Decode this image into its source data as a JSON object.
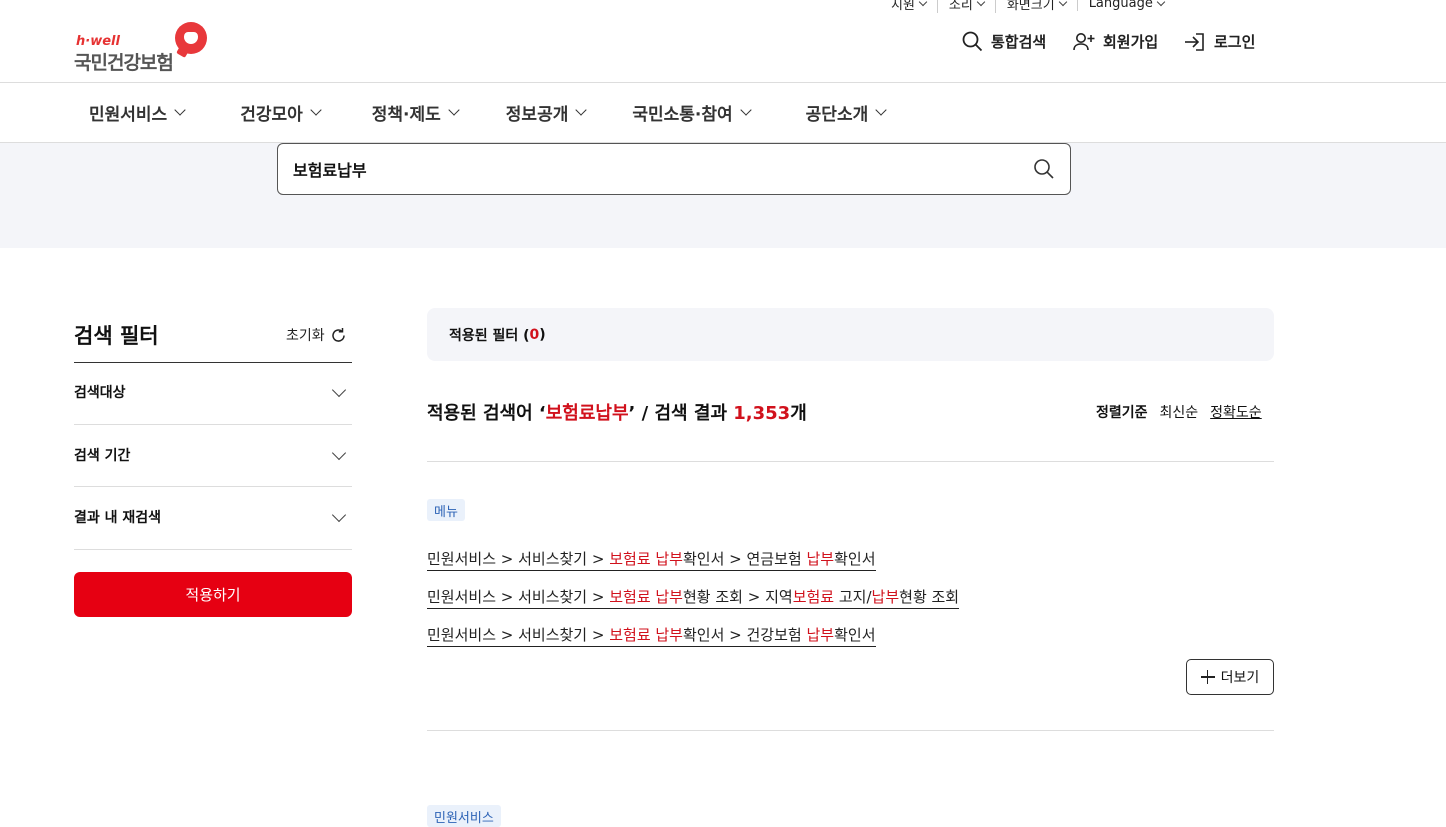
{
  "utility": [
    {
      "label": "지원"
    },
    {
      "label": "소리"
    },
    {
      "label": "화면크기"
    },
    {
      "label": "Language"
    }
  ],
  "logo": {
    "brand": "h·well",
    "name": "국민건강보험"
  },
  "header": {
    "search_label": "통합검색",
    "signup_label": "회원가입",
    "login_label": "로그인"
  },
  "gnb": [
    {
      "label": "민원서비스"
    },
    {
      "label": "건강모아"
    },
    {
      "label": "정책·제도"
    },
    {
      "label": "정보공개"
    },
    {
      "label": "국민소통·참여"
    },
    {
      "label": "공단소개"
    }
  ],
  "search": {
    "value": "보험료납부"
  },
  "filter": {
    "title": "검색 필터",
    "reset_label": "초기화",
    "sections": [
      {
        "label": "검색대상"
      },
      {
        "label": "검색 기간"
      },
      {
        "label": "결과 내 재검색"
      }
    ],
    "apply_label": "적용하기"
  },
  "applied": {
    "label": "적용된 필터 (",
    "count": "0",
    "close": ")"
  },
  "summary": {
    "prefix": "적용된 검색어 ‘",
    "keyword": "보험료납부",
    "middle": "’ / 검색 결과 ",
    "count": "1,353",
    "suffix": "개"
  },
  "sort": {
    "label": "정렬기준",
    "latest": "최신순",
    "accuracy": "정확도순"
  },
  "menu_section": {
    "tag": "메뉴",
    "paths": [
      [
        "민원서비스 > 서비스찾기 > ",
        "보험료 납부",
        "확인서 > 연금보험 ",
        "납부",
        "확인서"
      ],
      [
        "민원서비스 > 서비스찾기 > ",
        "보험료 납부",
        "현황 조회 > 지역",
        "보험료",
        " 고지/",
        "납부",
        "현황 조회"
      ],
      [
        "민원서비스 > 서비스찾기 > ",
        "보험료 납부",
        "확인서 > 건강보험 ",
        "납부",
        "확인서"
      ]
    ],
    "more_label": "더보기"
  },
  "next_section": {
    "tag": "민원서비스"
  },
  "colors": {
    "accent": "#e60012",
    "highlight": "#d1111c",
    "band": "#f4f5f9",
    "tag_bg": "#eaf1fb",
    "tag_text": "#2d63b6"
  }
}
